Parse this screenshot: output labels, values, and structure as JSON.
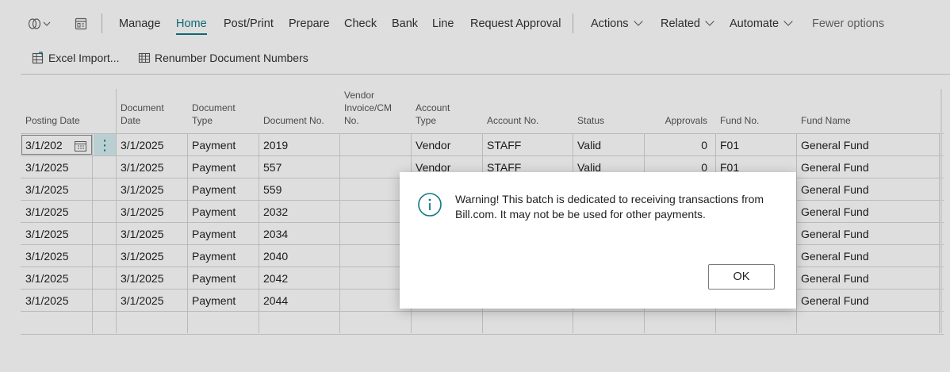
{
  "actionbar": {
    "items": [
      {
        "label": "Manage"
      },
      {
        "label": "Home",
        "active": true
      },
      {
        "label": "Post/Print"
      },
      {
        "label": "Prepare"
      },
      {
        "label": "Check"
      },
      {
        "label": "Bank"
      },
      {
        "label": "Line"
      },
      {
        "label": "Request Approval"
      }
    ],
    "menus": [
      {
        "label": "Actions"
      },
      {
        "label": "Related"
      },
      {
        "label": "Automate"
      }
    ],
    "fewer_options": "Fewer options",
    "accent_color": "#0f7886"
  },
  "toolbar2": {
    "excel_import": "Excel Import...",
    "renumber": "Renumber Document Numbers"
  },
  "grid": {
    "headers": {
      "posting_date": "Posting Date",
      "document_date_1": "Document",
      "document_date_2": "Date",
      "document_type_1": "Document",
      "document_type_2": "Type",
      "document_no": "Document No.",
      "vendor_inv_1": "Vendor",
      "vendor_inv_2": "Invoice/CM",
      "vendor_inv_3": "No.",
      "account_type_1": "Account",
      "account_type_2": "Type",
      "account_no": "Account No.",
      "status": "Status",
      "approvals": "Approvals",
      "fund_no": "Fund No.",
      "fund_name": "Fund Name"
    },
    "editing_value": "3/1/202",
    "rows": [
      {
        "posting_date": "3/1/2025",
        "document_date": "3/1/2025",
        "document_type": "Payment",
        "document_no": "2019",
        "account_type": "Vendor",
        "account_no": "STAFF",
        "status": "Valid",
        "approvals": "0",
        "fund_no": "F01",
        "fund_name": "General Fund"
      },
      {
        "posting_date": "3/1/2025",
        "document_date": "3/1/2025",
        "document_type": "Payment",
        "document_no": "557",
        "account_type": "Vendor",
        "account_no": "STAFF",
        "status": "Valid",
        "approvals": "0",
        "fund_no": "F01",
        "fund_name": "General Fund"
      },
      {
        "posting_date": "3/1/2025",
        "document_date": "3/1/2025",
        "document_type": "Payment",
        "document_no": "559",
        "fund_name": "General Fund"
      },
      {
        "posting_date": "3/1/2025",
        "document_date": "3/1/2025",
        "document_type": "Payment",
        "document_no": "2032",
        "fund_name": "General Fund"
      },
      {
        "posting_date": "3/1/2025",
        "document_date": "3/1/2025",
        "document_type": "Payment",
        "document_no": "2034",
        "fund_name": "General Fund"
      },
      {
        "posting_date": "3/1/2025",
        "document_date": "3/1/2025",
        "document_type": "Payment",
        "document_no": "2040",
        "fund_name": "General Fund"
      },
      {
        "posting_date": "3/1/2025",
        "document_date": "3/1/2025",
        "document_type": "Payment",
        "document_no": "2042",
        "fund_name": "General Fund"
      },
      {
        "posting_date": "3/1/2025",
        "document_date": "3/1/2025",
        "document_type": "Payment",
        "document_no": "2044",
        "fund_name": "General Fund"
      }
    ]
  },
  "dialog": {
    "message": "Warning! This batch is dedicated to receiving transactions from Bill.com. It may not be be used for other payments.",
    "ok_label": "OK",
    "icon": "info-icon"
  }
}
